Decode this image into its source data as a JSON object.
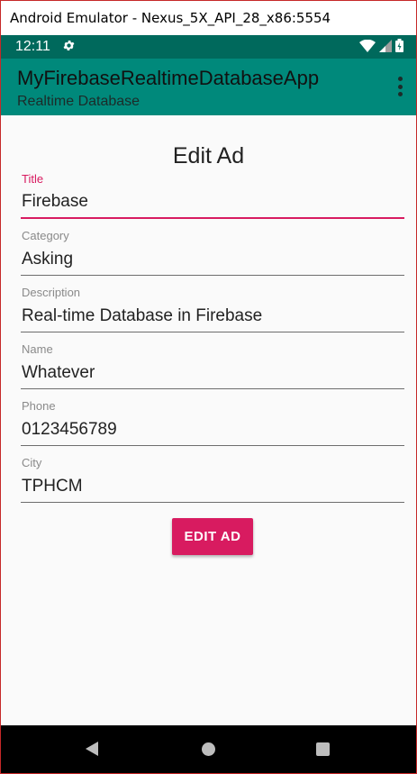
{
  "window": {
    "title": "Android Emulator - Nexus_5X_API_28_x86:5554"
  },
  "statusbar": {
    "time": "12:11",
    "settings_icon": "gear-icon",
    "wifi_icon": "wifi-icon",
    "signal_icon": "signal-icon",
    "battery_icon": "battery-icon"
  },
  "appbar": {
    "title": "MyFirebaseRealtimeDatabaseApp",
    "subtitle": "Realtime Database",
    "menu_icon": "overflow-menu-icon"
  },
  "form": {
    "heading": "Edit Ad",
    "fields": [
      {
        "label": "Title",
        "value": "Firebase",
        "focused": true
      },
      {
        "label": "Category",
        "value": "Asking",
        "focused": false
      },
      {
        "label": "Description",
        "value": "Real-time Database in Firebase",
        "focused": false
      },
      {
        "label": "Name",
        "value": "Whatever",
        "focused": false
      },
      {
        "label": "Phone",
        "value": "0123456789",
        "focused": false
      },
      {
        "label": "City",
        "value": "TPHCM",
        "focused": false
      }
    ],
    "submit_label": "EDIT AD"
  },
  "colors": {
    "primary_dark": "#00695c",
    "primary": "#00897b",
    "accent": "#d81b60"
  }
}
